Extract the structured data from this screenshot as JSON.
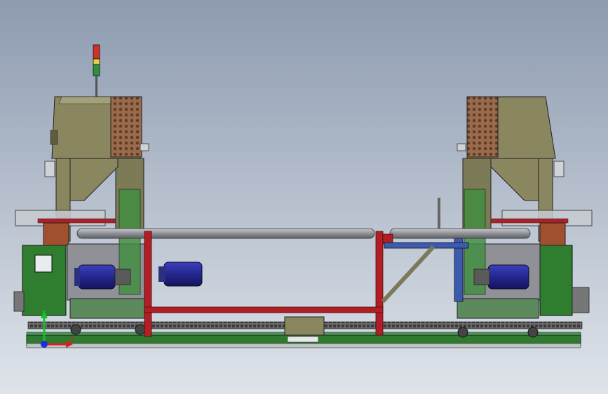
{
  "viewport": {
    "background_top": "#8d9bb0",
    "background_bottom": "#dfe4ea"
  },
  "triad": {
    "x_label": "X",
    "y_label": "Y",
    "x_color": "#d62020",
    "y_color": "#15c02a",
    "z_color": "#1c2fd9"
  },
  "colors": {
    "cabinet_body": "#8a8760",
    "cabinet_dark": "#5f5d40",
    "perforated_panel": "#9a6a4a",
    "frame_red": "#b21e26",
    "roller_grey": "#8f9196",
    "motor_blue": "#24268f",
    "electrical_box_green": "#2f7d2f",
    "base_rail_green": "#2f7a2f",
    "bracket_blue": "#3b5bb0",
    "chain": "#3a3a3a",
    "beacon_red": "#d0302a",
    "beacon_green": "#2f8f3a"
  }
}
